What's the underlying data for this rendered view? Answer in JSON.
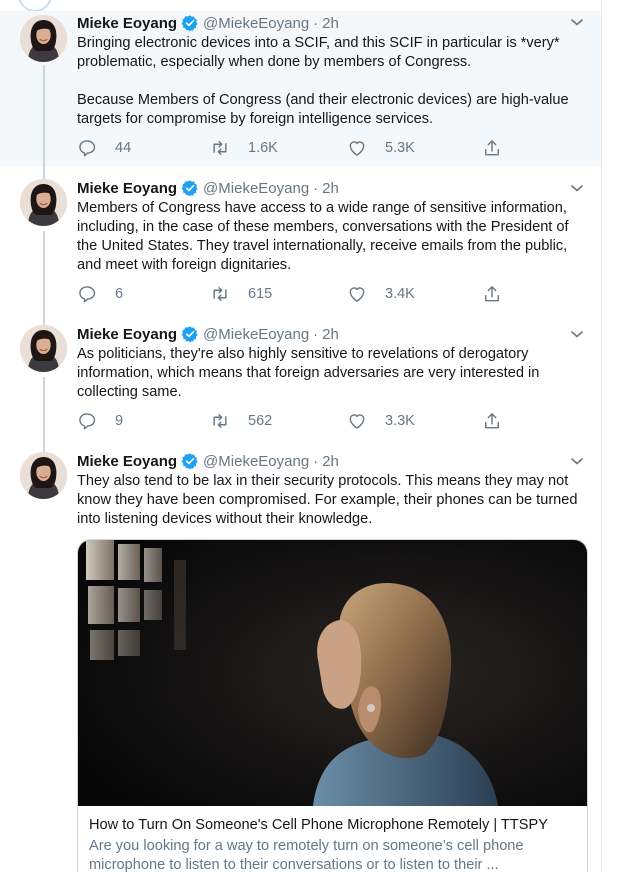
{
  "tweets": [
    {
      "name": "Mieke Eoyang",
      "handle": "@MiekeEoyang",
      "time": "2h",
      "text": "Bringing electronic devices into a SCIF, and this SCIF in particular is *very* problematic, especially when done by members of Congress.\n\nBecause Members of Congress (and their electronic devices) are high-value targets for compromise by foreign intelligence services.",
      "replies": "44",
      "retweets": "1.6K",
      "likes": "5.3K"
    },
    {
      "name": "Mieke Eoyang",
      "handle": "@MiekeEoyang",
      "time": "2h",
      "text": "Members of Congress have access to a wide range of sensitive information, including, in the case of these members, conversations with the President of the United States. They travel internationally, receive emails from the public, and meet with foreign dignitaries.",
      "replies": "6",
      "retweets": "615",
      "likes": "3.4K"
    },
    {
      "name": "Mieke Eoyang",
      "handle": "@MiekeEoyang",
      "time": "2h",
      "text": "As politicians, they're also  highly sensitive to revelations of derogatory information, which means that foreign adversaries are very interested in collecting same.",
      "replies": "9",
      "retweets": "562",
      "likes": "3.3K"
    },
    {
      "name": "Mieke Eoyang",
      "handle": "@MiekeEoyang",
      "time": "2h",
      "text": "They also tend to be lax in their security protocols. This means they may not know they have been compromised. For example, their phones can be turned into listening devices without their knowledge.",
      "card": {
        "title": "How to Turn On Someone's Cell Phone Microphone Remotely | TTSPY",
        "description": "Are you looking for a way to remotely turn on someone’s cell phone microphone to listen to their conversations or to listen to their ..."
      }
    }
  ],
  "icons": {
    "verified": "verified-badge-icon",
    "caret": "chevron-down-icon",
    "reply": "reply-icon",
    "retweet": "retweet-icon",
    "like": "heart-icon",
    "share": "share-icon"
  },
  "colors": {
    "accent": "#1da1f2",
    "secondary_text": "#657786",
    "highlight_bg": "#f5f8fa",
    "thread_line": "#ccd6dd"
  }
}
